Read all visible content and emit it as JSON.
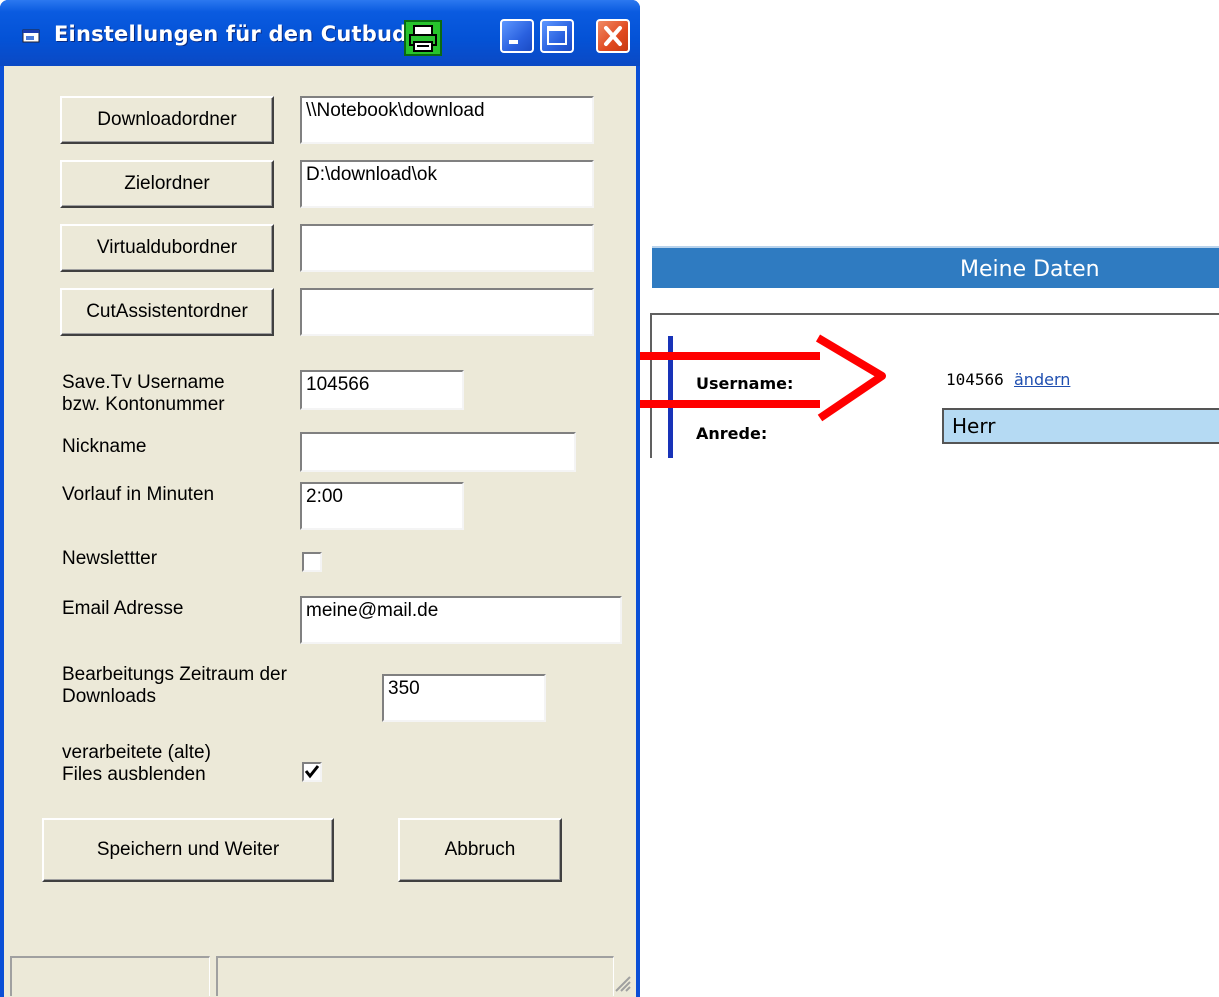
{
  "window": {
    "title": "Einstellungen für den Cutbuddy"
  },
  "form": {
    "folders": [
      {
        "button": "Downloadordner",
        "value": "\\\\Notebook\\download"
      },
      {
        "button": "Zielordner",
        "value": "D:\\download\\ok"
      },
      {
        "button": "Virtualdubordner",
        "value": ""
      },
      {
        "button": "CutAssistentordner",
        "value": ""
      }
    ],
    "username_label": "Save.Tv Username\nbzw. Kontonummer",
    "username_value": "104566",
    "nickname_label": "Nickname",
    "nickname_value": "",
    "vorlauf_label": "Vorlauf in Minuten",
    "vorlauf_value": "2:00",
    "newsletter_label": "Newslettter",
    "newsletter_checked": false,
    "email_label": "Email Adresse",
    "email_value": "meine@mail.de",
    "zeitraum_label": "Bearbeitungs Zeitraum der\nDownloads",
    "zeitraum_value": "350",
    "alte_label": "verarbeitete (alte)\nFiles ausblenden",
    "alte_checked": true,
    "save_button": "Speichern und Weiter",
    "cancel_button": "Abbruch"
  },
  "web": {
    "header": "Meine Daten",
    "username_label": "Username:",
    "username_value": "104566",
    "change_link": "ändern",
    "anrede_label": "Anrede:",
    "anrede_value": "Herr"
  },
  "colors": {
    "titlebar": "#0452d6",
    "dialog": "#ece9d8",
    "web_header": "#2f7bc1",
    "select_bg": "#b5daf3",
    "arrow": "#ff0000"
  }
}
